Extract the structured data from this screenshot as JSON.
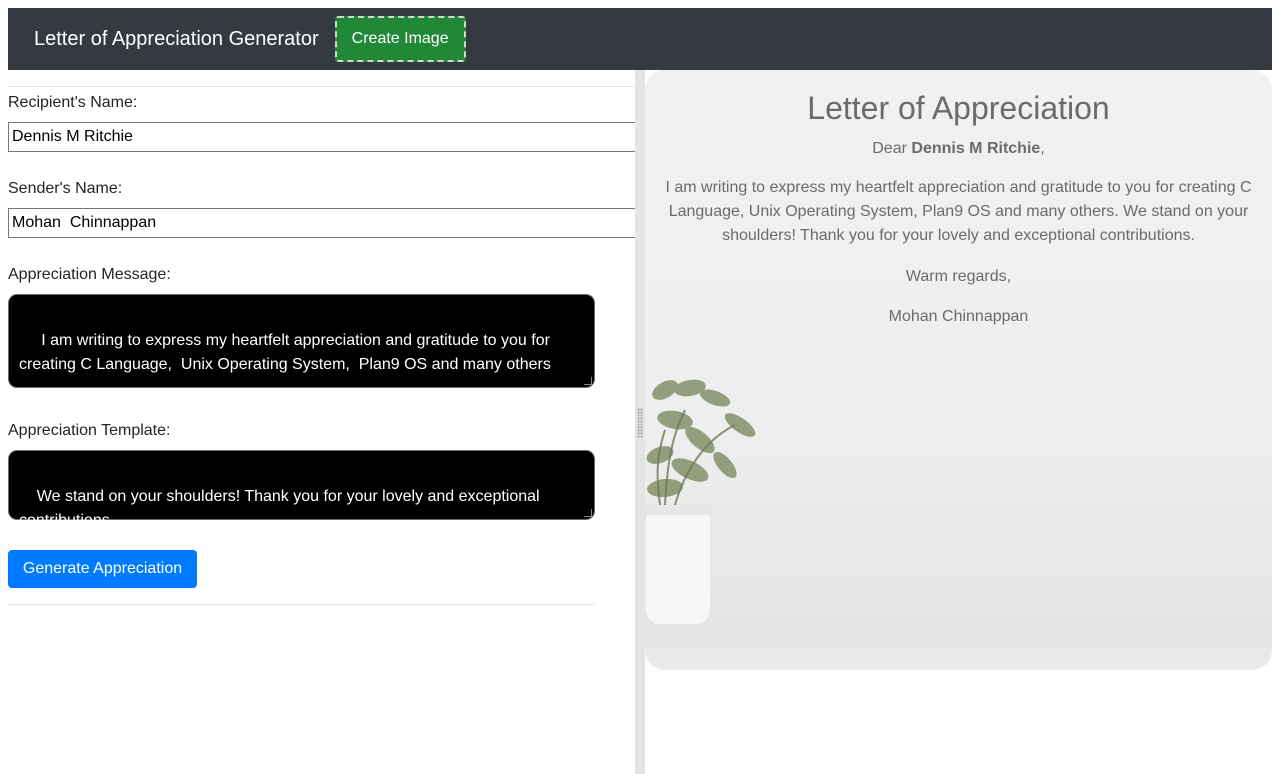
{
  "navbar": {
    "title": "Letter of Appreciation Generator",
    "create_image_label": "Create Image"
  },
  "form": {
    "recipient_label": "Recipient's Name:",
    "recipient_value": "Dennis M Ritchie",
    "sender_label": "Sender's Name:",
    "sender_value": "Mohan  Chinnappan",
    "message_label": "Appreciation Message:",
    "message_value": " I am writing to express my heartfelt appreciation and gratitude to you for creating C Language,  Unix Operating System,  Plan9 OS and many others",
    "template_label": "Appreciation Template:",
    "template_value": "We stand on your shoulders! Thank you for your lovely and exceptional contributions.",
    "generate_label": "Generate Appreciation"
  },
  "letter": {
    "title": "Letter of Appreciation",
    "greeting": "Dear",
    "recipient": "Dennis M Ritchie",
    "greeting_suffix": ",",
    "body": "I am writing to express my heartfelt appreciation and gratitude to you for creating C Language, Unix Operating System, Plan9 OS and many others. We stand on your shoulders! Thank you for your lovely and exceptional contributions.",
    "closing": "Warm regards,",
    "signature": "Mohan Chinnappan"
  },
  "colors": {
    "navbar_bg": "#343a40",
    "create_button": "#218838",
    "generate_button": "#007bff",
    "textarea_bg": "#000000"
  }
}
